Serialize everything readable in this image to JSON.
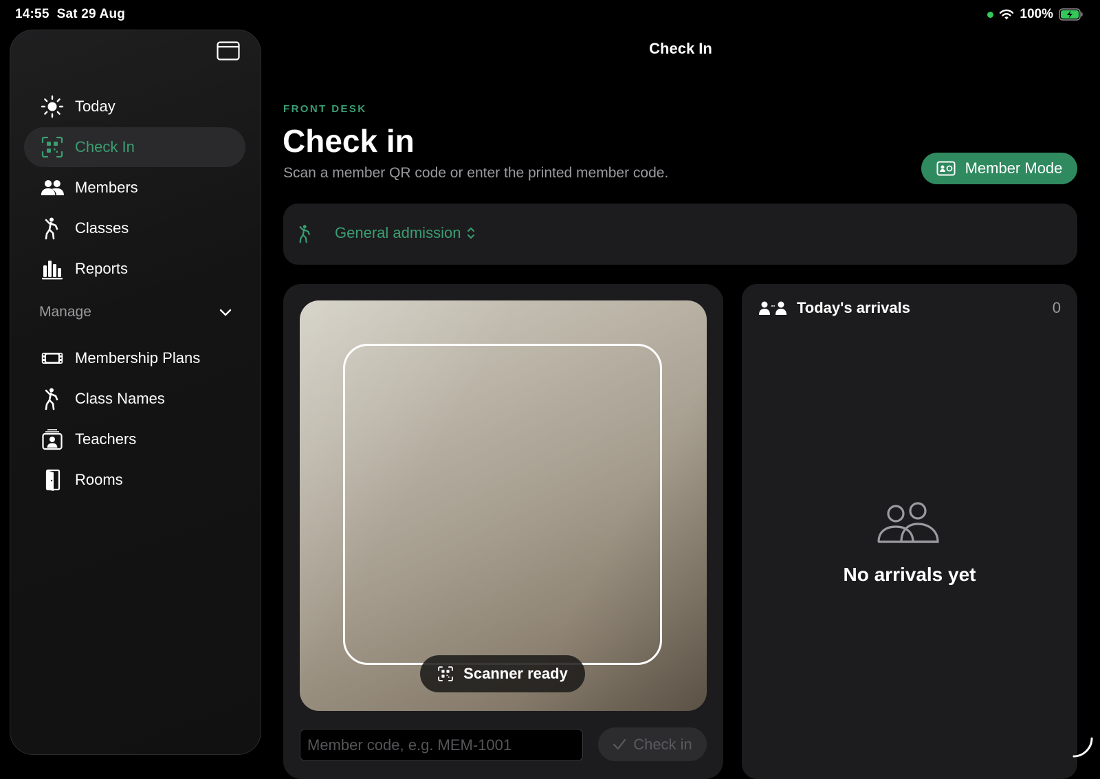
{
  "status_bar": {
    "time": "14:55",
    "date": "Sat 29 Aug",
    "battery": "100%"
  },
  "colors": {
    "accent": "#3b9e72",
    "member_mode_bg": "#2f8a5f",
    "background": "#000000",
    "card": "#1c1c1e"
  },
  "sidebar": {
    "items": [
      {
        "label": "Today",
        "icon": "sun-icon"
      },
      {
        "label": "Check In",
        "icon": "qr-scan-icon",
        "active": true
      },
      {
        "label": "Members",
        "icon": "people-icon"
      },
      {
        "label": "Classes",
        "icon": "figure-dance-icon"
      },
      {
        "label": "Reports",
        "icon": "bar-chart-icon"
      }
    ],
    "section": {
      "label": "Manage",
      "icon": "chevron-down-icon"
    },
    "manage_items": [
      {
        "label": "Membership Plans",
        "icon": "ticket-icon"
      },
      {
        "label": "Class Names",
        "icon": "figure-dance-icon"
      },
      {
        "label": "Teachers",
        "icon": "person-badge-icon"
      },
      {
        "label": "Rooms",
        "icon": "door-icon"
      }
    ]
  },
  "header": {
    "nav_title": "Check In"
  },
  "main": {
    "eyebrow": "FRONT DESK",
    "title": "Check in",
    "subtitle": "Scan a member QR code or enter the printed member code.",
    "member_mode_label": "Member Mode",
    "admission": {
      "selected": "General admission"
    },
    "scanner": {
      "status": "Scanner ready",
      "input_placeholder": "Member code, e.g. MEM-1001",
      "input_value": "",
      "checkin_label": "Check in"
    },
    "arrivals": {
      "title": "Today's arrivals",
      "count": "0",
      "empty_text": "No arrivals yet"
    }
  }
}
